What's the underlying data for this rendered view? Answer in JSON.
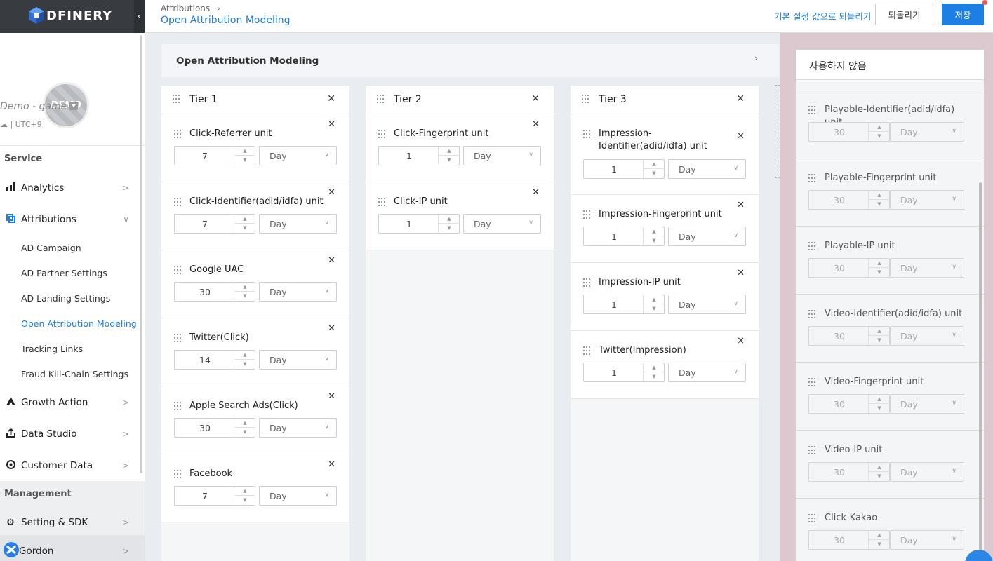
{
  "app": {
    "logo_text": "DFINERY",
    "collapse_glyph": "‹"
  },
  "profile": {
    "avatar_text": "DEMO",
    "name": "Demo - game",
    "platform_icons": "☁ ",
    "timezone": "UTC+9"
  },
  "sidebar": {
    "service_label": "Service",
    "management_label": "Management",
    "items": [
      {
        "label": "Analytics",
        "icon": "bar-chart-icon"
      },
      {
        "label": "Attributions",
        "icon": "attribution-icon"
      },
      {
        "label": "Growth Action",
        "icon": "growth-icon"
      },
      {
        "label": "Data Studio",
        "icon": "upload-icon"
      },
      {
        "label": "Customer Data",
        "icon": "target-icon"
      },
      {
        "label": "Setting & SDK",
        "icon": "gear-icon"
      },
      {
        "label": "Gordon",
        "icon": "gordon-icon"
      }
    ],
    "attribution_sub": [
      "AD Campaign",
      "AD Partner Settings",
      "AD Landing Settings",
      "Open Attribution Modeling",
      "Tracking Links",
      "Fraud Kill-Chain Settings"
    ]
  },
  "header": {
    "breadcrumb": "Attributions",
    "title": "Open Attribution Modeling",
    "reset_label": "기본 설정 값으로 되돌리기",
    "revert_label": "되돌리기",
    "save_label": "저장"
  },
  "panel": {
    "title": "Open Attribution Modeling"
  },
  "tiers": [
    {
      "title": "Tier 1",
      "items": [
        {
          "name": "Click-Referrer unit",
          "value": "7",
          "unit": "Day"
        },
        {
          "name": "Click-Identifier(adid/idfa) unit",
          "value": "7",
          "unit": "Day"
        },
        {
          "name": "Google UAC",
          "value": "30",
          "unit": "Day"
        },
        {
          "name": "Twitter(Click)",
          "value": "14",
          "unit": "Day"
        },
        {
          "name": "Apple Search Ads(Click)",
          "value": "30",
          "unit": "Day"
        },
        {
          "name": "Facebook",
          "value": "7",
          "unit": "Day"
        }
      ]
    },
    {
      "title": "Tier 2",
      "items": [
        {
          "name": "Click-Fingerprint unit",
          "value": "1",
          "unit": "Day"
        },
        {
          "name": "Click-IP unit",
          "value": "1",
          "unit": "Day"
        }
      ]
    },
    {
      "title": "Tier 3",
      "items": [
        {
          "name": "Impression-Identifier(adid/idfa) unit",
          "value": "1",
          "unit": "Day"
        },
        {
          "name": "Impression-Fingerprint unit",
          "value": "1",
          "unit": "Day"
        },
        {
          "name": "Impression-IP unit",
          "value": "1",
          "unit": "Day"
        },
        {
          "name": "Twitter(Impression)",
          "value": "1",
          "unit": "Day"
        }
      ]
    }
  ],
  "unused": {
    "title": "사용하지 않음",
    "items": [
      {
        "name": "Playable-Identifier(adid/idfa) unit",
        "value": "30",
        "unit": "Day"
      },
      {
        "name": "Playable-Fingerprint unit",
        "value": "30",
        "unit": "Day"
      },
      {
        "name": "Playable-IP unit",
        "value": "30",
        "unit": "Day"
      },
      {
        "name": "Video-Identifier(adid/idfa) unit",
        "value": "30",
        "unit": "Day"
      },
      {
        "name": "Video-Fingerprint unit",
        "value": "30",
        "unit": "Day"
      },
      {
        "name": "Video-IP unit",
        "value": "30",
        "unit": "Day"
      },
      {
        "name": "Click-Kakao",
        "value": "30",
        "unit": "Day"
      }
    ]
  },
  "colors": {
    "accent": "#1d7ee4",
    "sidebar_dark": "#383b40"
  }
}
